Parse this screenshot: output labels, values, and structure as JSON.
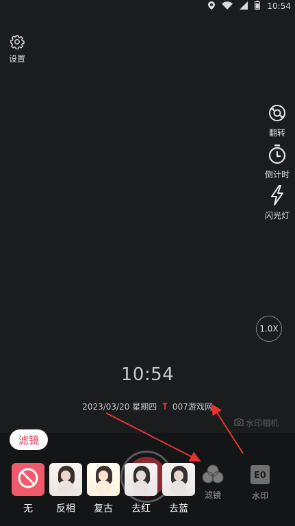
{
  "status_bar": {
    "time": "10:54"
  },
  "settings": {
    "label": "设置"
  },
  "side_tools": [
    {
      "label": "翻转",
      "icon": "flip-camera-icon"
    },
    {
      "label": "倒计时",
      "icon": "timer-icon"
    },
    {
      "label": "闪光灯",
      "icon": "flash-icon"
    }
  ],
  "zoom": {
    "label": "1.0X"
  },
  "watermark": {
    "clock": "10:54",
    "date": "2023/03/20",
    "weekday": "星期四",
    "location": "007游戏网",
    "camera_label": "水印相机"
  },
  "bottom": {
    "filter_tag": "滤镜",
    "filter_button_label": "滤镜",
    "watermark_button_label": "水印",
    "watermark_button_glyph": "E0"
  },
  "filters": [
    {
      "label": "无",
      "type": "none"
    },
    {
      "label": "反相",
      "type": "invert"
    },
    {
      "label": "复古",
      "type": "vintage"
    },
    {
      "label": "去红",
      "type": "red"
    },
    {
      "label": "去蓝",
      "type": "blue"
    }
  ],
  "colors": {
    "accent": "#e23e5a",
    "none_filter_bg": "#f05a6a",
    "arrow": "#e8322c"
  }
}
